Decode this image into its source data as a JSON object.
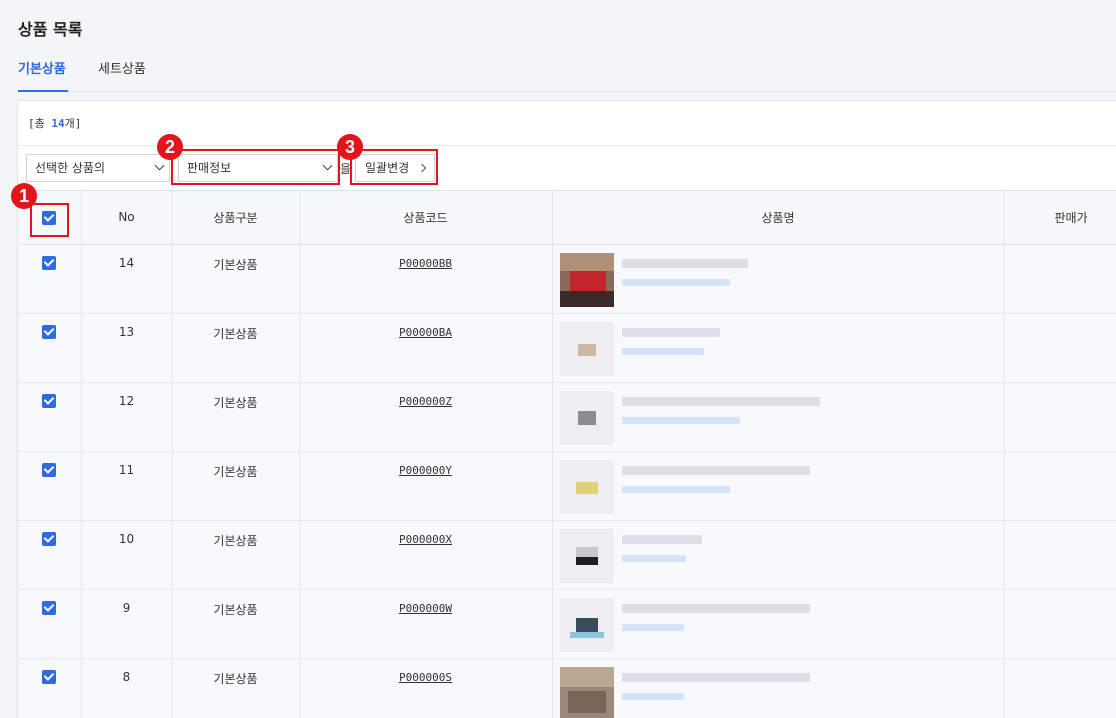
{
  "page": {
    "title": "상품 목록"
  },
  "tabs": [
    {
      "label": "기본상품",
      "active": true
    },
    {
      "label": "세트상품",
      "active": false
    }
  ],
  "summary": {
    "prefix": "[총 ",
    "count": "14",
    "suffix": "개]"
  },
  "toolbar": {
    "target_select": "선택한 상품의",
    "info_select": "판매정보",
    "particle": "을",
    "bulk_button": "일괄변경"
  },
  "table": {
    "columns": [
      "No",
      "상품구분",
      "상품코드",
      "상품명",
      "판매가"
    ],
    "rows": [
      {
        "no": "14",
        "type": "기본상품",
        "code": "P00000BB",
        "checked": true
      },
      {
        "no": "13",
        "type": "기본상품",
        "code": "P00000BA",
        "checked": true
      },
      {
        "no": "12",
        "type": "기본상품",
        "code": "P000000Z",
        "checked": true
      },
      {
        "no": "11",
        "type": "기본상품",
        "code": "P000000Y",
        "checked": true
      },
      {
        "no": "10",
        "type": "기본상품",
        "code": "P000000X",
        "checked": true
      },
      {
        "no": "9",
        "type": "기본상품",
        "code": "P000000W",
        "checked": true
      },
      {
        "no": "8",
        "type": "기본상품",
        "code": "P000000S",
        "checked": true
      }
    ]
  },
  "annotations": [
    "1",
    "2",
    "3"
  ],
  "colors": {
    "accent": "#2c6ce0",
    "annotation": "#e4141c"
  }
}
